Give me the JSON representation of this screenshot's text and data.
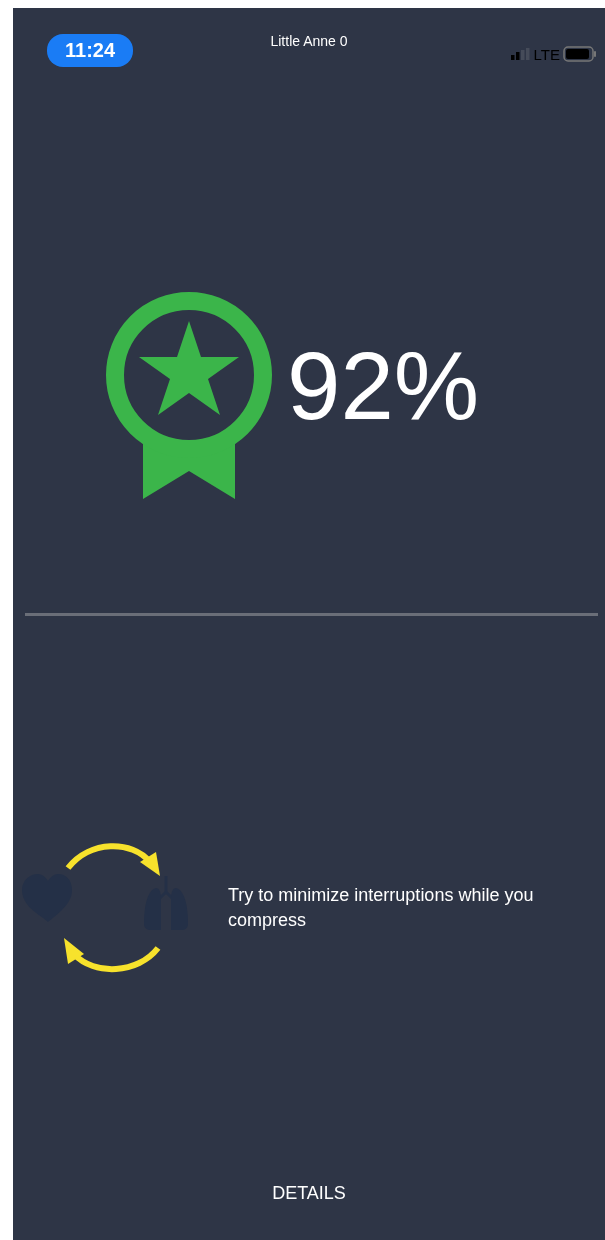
{
  "status_bar": {
    "time": "11:24",
    "title": "Little Anne 0",
    "network": "LTE"
  },
  "result": {
    "score": "92%"
  },
  "tip": {
    "text": "Try to minimize interruptions while you compress"
  },
  "details_button": {
    "label": "DETAILS"
  }
}
